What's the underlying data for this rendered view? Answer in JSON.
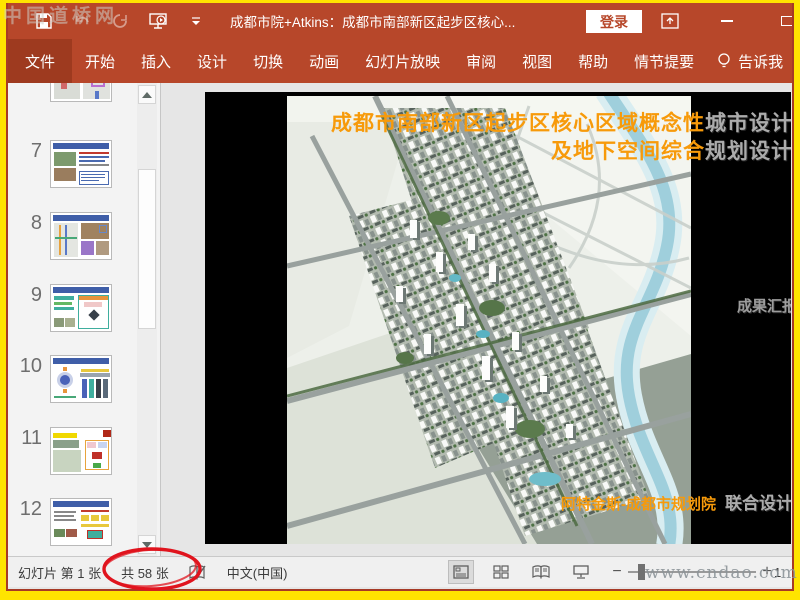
{
  "watermarks": {
    "site_top": "中国道桥网",
    "site_bottom": "www.cndao.com"
  },
  "title_bar": {
    "document_title": "成都市院+Atkins：成都市南部新区起步区核心...",
    "login_label": "登录"
  },
  "ribbon": {
    "active_tab": "文件",
    "tabs": [
      "文件",
      "开始",
      "插入",
      "设计",
      "切换",
      "动画",
      "幻灯片放映",
      "审阅",
      "视图",
      "帮助",
      "情节提要"
    ],
    "tell_me_label": "告诉我"
  },
  "thumbnail_panel": {
    "slides": [
      {
        "number": ""
      },
      {
        "number": "7"
      },
      {
        "number": "8"
      },
      {
        "number": "9"
      },
      {
        "number": "10"
      },
      {
        "number": "11"
      },
      {
        "number": "12"
      }
    ]
  },
  "slide": {
    "title_line1": {
      "orange": "成都市南部新区起步区核心区域概念性",
      "gray": "城市设计"
    },
    "title_line2": {
      "orange": "及地下空间综合",
      "gray": "规划设计"
    },
    "side_label": "成果汇报",
    "credit": {
      "orange": "阿特金斯-成都市规划院",
      "gray": "联合设计"
    }
  },
  "status_bar": {
    "slide_position": "幻灯片 第 1 张",
    "slide_total": "共 58 张",
    "language": "中文(中国)",
    "zoom_value_partial": "1"
  },
  "colors": {
    "chrome_red": "#B7472A",
    "chrome_red_dark": "#9E3A1F",
    "accent_orange": "#F79A0A",
    "annotation_red": "#E0141E",
    "border_yellow": "#FFE400"
  }
}
